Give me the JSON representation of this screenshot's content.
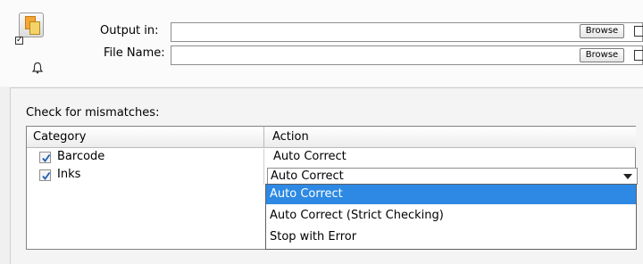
{
  "output": {
    "output_in_label": "Output in:",
    "file_name_label": "File Name:",
    "output_in_value": "",
    "file_name_value": "",
    "browse_label": "Browse"
  },
  "mismatch": {
    "label": "Check for mismatches:",
    "columns": [
      "Category",
      "Action"
    ],
    "rows": [
      {
        "category": "Barcode",
        "checked": true,
        "action": "Auto Correct"
      },
      {
        "category": "Inks",
        "checked": true,
        "action": "Auto Correct"
      }
    ],
    "dropdown_options": [
      "Auto Correct",
      "Auto Correct (Strict Checking)",
      "Stop with Error"
    ],
    "selected_option": "Auto Correct"
  },
  "colors": {
    "selection": "#2d89e3",
    "checkmark": "#1f5fb5"
  },
  "icons": {
    "app": "document-pages-icon",
    "notify": "bell-icon",
    "checkbox": "checkmark-icon",
    "dropdown": "dropdown-arrow-icon"
  }
}
